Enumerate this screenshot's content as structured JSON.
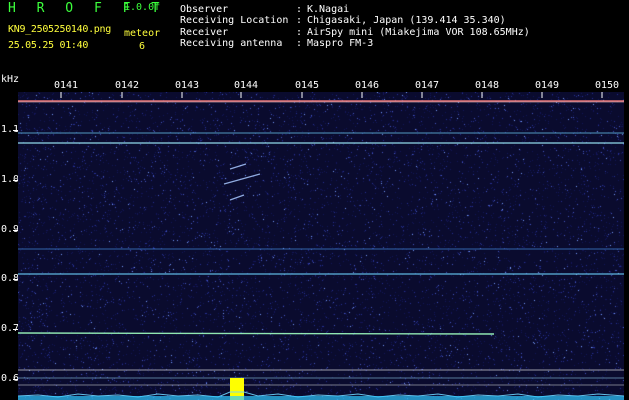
{
  "header": {
    "logo": "H R O F F T",
    "version": "1.0.0f",
    "filename": "KN9_2505250140.png",
    "datetime": "25.05.25 01:40",
    "meteor_label": "meteor",
    "meteor_count": "6"
  },
  "info": [
    {
      "label": "Observer",
      "value": "K.Nagai"
    },
    {
      "label": "Receiving Location",
      "value": "Chigasaki, Japan (139.414 35.340)"
    },
    {
      "label": "Receiver",
      "value": "AirSpy mini (Miakejima VOR 108.65MHz)"
    },
    {
      "label": "Receiving antenna",
      "value": "Maspro FM-3"
    }
  ],
  "axis": {
    "y_unit": "kHz",
    "y_ticks": [
      "1.1",
      "1.0",
      "0.9",
      "0.8",
      "0.7",
      "0.6"
    ],
    "x_ticks": [
      "0141",
      "0142",
      "0143",
      "0144",
      "0145",
      "0146",
      "0147",
      "0148",
      "0149",
      "0150"
    ]
  },
  "colors": {
    "background": "#000000",
    "plot_bg": "#0a0b2e",
    "logo": "#3cff3c",
    "meteor": "#ffff3c",
    "carrier": "#ff6060",
    "signal": "#4fd6ff"
  }
}
